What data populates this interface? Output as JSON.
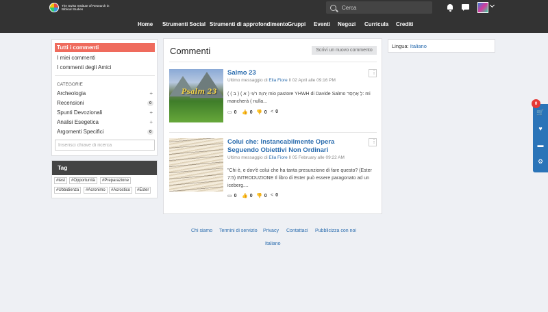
{
  "header": {
    "logo_text": "The Swiss Institute of Research in Biblical Studies",
    "search_placeholder": "Cerca",
    "nav": [
      "Home",
      "Strumenti Social",
      "Strumenti di approfondimento",
      "Gruppi",
      "Eventi",
      "Negozi",
      "Curricula",
      "Crediti"
    ]
  },
  "sidebar": {
    "active": "Tutti i commenti",
    "links": [
      "I miei commenti",
      "I commenti degli Amici"
    ],
    "category_heading": "CATEGORIE",
    "categories": [
      {
        "label": "Archeologia",
        "marker": "+"
      },
      {
        "label": "Recensioni",
        "marker": "0"
      },
      {
        "label": "Spunti Devozionali",
        "marker": "+"
      },
      {
        "label": "Analisi Esegetica",
        "marker": "+"
      },
      {
        "label": "Argomenti Specifici",
        "marker": "0"
      }
    ],
    "search_placeholder": "Inserisci chiave di ricerca"
  },
  "tags": {
    "heading": "Tag",
    "items": [
      "#test",
      "#Opportunità",
      "#Preparazione",
      "#Ubbidienza",
      "#Acronimo",
      "#Acrostico",
      "#Ester"
    ]
  },
  "main": {
    "title": "Commenti",
    "new_button": "Scrivi un nuovo commento",
    "posts": [
      {
        "title": "Salmo 23",
        "thumb_text": "Psalm 23",
        "meta_prefix": "Ultimo messaggio di",
        "author": "Elia Fiore",
        "date": "Il 02 April alle 09:16 PM",
        "body": "( יְהוָה רֹעִי ( א ) ( ב ) mio pastore YHWH di Davide Salmo לְ אֶחְסָר: mi mancherà ( nulla...",
        "comments": "0",
        "likes": "0",
        "dislikes": "0",
        "shares": "0"
      },
      {
        "title": "Colui che: Instancabilmente Opera Seguendo Obiettivi Non Ordinari",
        "meta_prefix": "Ultimo messaggio di",
        "author": "Elia Fiore",
        "date": "Il 05 February alle 09:22 AM",
        "body": "\"Chi è, e dov'è colui che ha tanta presunzione di fare questo? (Ester 7:5) INTRODUZIONE Il libro di Ester può essere paragonato ad un iceberg....",
        "comments": "0",
        "likes": "0",
        "dislikes": "0",
        "shares": "0"
      }
    ]
  },
  "language": {
    "label": "Lingua:",
    "value": "Italiano"
  },
  "footer": {
    "links": [
      "Chi siamo",
      "Termini di servizio",
      "Privacy",
      "Contattaci",
      "Pubblicizza con noi"
    ],
    "language": "Italiano"
  },
  "widget": {
    "cart_count": "0"
  },
  "colors": {
    "topbar": "#333333",
    "accent_red": "#ef6b5d",
    "link_blue": "#2a6cae",
    "widget_blue": "#2a74b8"
  }
}
